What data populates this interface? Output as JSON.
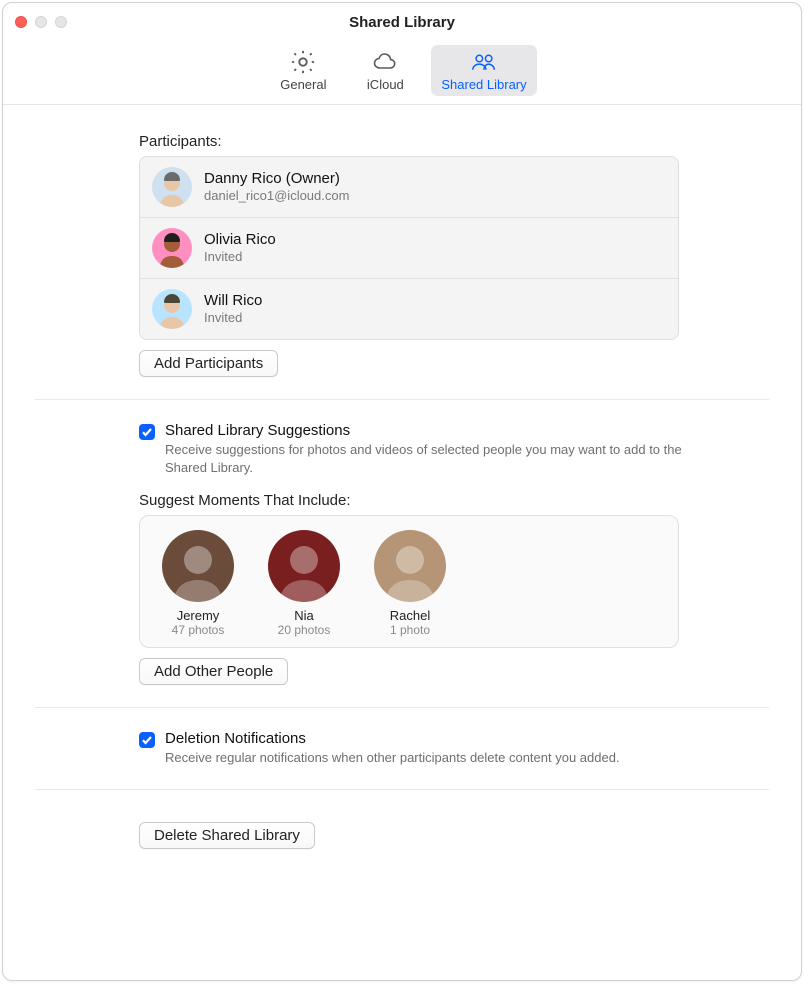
{
  "window": {
    "title": "Shared Library"
  },
  "toolbar": {
    "general": "General",
    "icloud": "iCloud",
    "shared_library": "Shared Library"
  },
  "participants": {
    "label": "Participants:",
    "add_button": "Add Participants",
    "items": [
      {
        "name": "Danny Rico (Owner)",
        "sub": "daniel_rico1@icloud.com",
        "avatar_bg": "#cfe0f0",
        "avatar_face": "#e8c7a8",
        "avatar_top": "#6b6b6b"
      },
      {
        "name": "Olivia Rico",
        "sub": "Invited",
        "avatar_bg": "#ff8fc0",
        "avatar_face": "#a55c3a",
        "avatar_top": "#1f1f1f"
      },
      {
        "name": "Will Rico",
        "sub": "Invited",
        "avatar_bg": "#b9e4ff",
        "avatar_face": "#e8c7a8",
        "avatar_top": "#4b4935"
      }
    ]
  },
  "suggestions": {
    "title": "Shared Library Suggestions",
    "desc": "Receive suggestions for photos and videos of selected people you may want to add to the Shared Library.",
    "checked": true,
    "moments_label": "Suggest Moments That Include:",
    "add_people_button": "Add Other People",
    "people": [
      {
        "name": "Jeremy",
        "count": "47 photos",
        "bg": "#6b4c3a"
      },
      {
        "name": "Nia",
        "count": "20 photos",
        "bg": "#7a1f1f"
      },
      {
        "name": "Rachel",
        "count": "1 photo",
        "bg": "#b59575"
      }
    ]
  },
  "deletion": {
    "title": "Deletion Notifications",
    "desc": "Receive regular notifications when other participants delete content you added.",
    "checked": true
  },
  "delete_button": "Delete Shared Library",
  "colors": {
    "accent": "#0a60ff"
  }
}
